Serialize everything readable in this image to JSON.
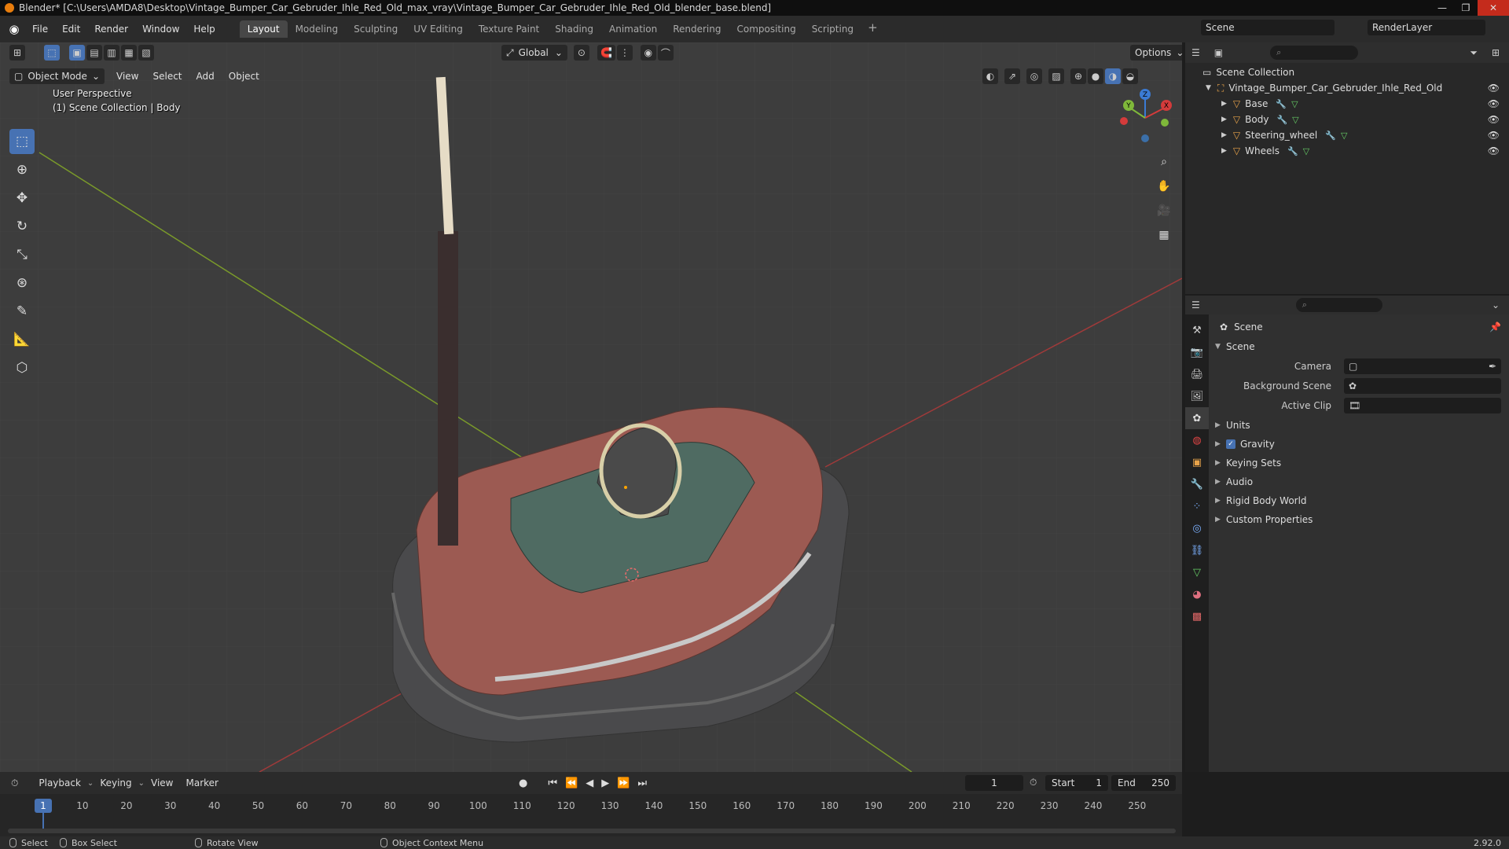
{
  "window": {
    "title": "Blender* [C:\\Users\\AMDA8\\Desktop\\Vintage_Bumper_Car_Gebruder_Ihle_Red_Old_max_vray\\Vintage_Bumper_Car_Gebruder_Ihle_Red_Old_blender_base.blend]"
  },
  "menu": {
    "file": "File",
    "edit": "Edit",
    "render": "Render",
    "window": "Window",
    "help": "Help"
  },
  "workspaces": [
    "Layout",
    "Modeling",
    "Sculpting",
    "UV Editing",
    "Texture Paint",
    "Shading",
    "Animation",
    "Rendering",
    "Compositing",
    "Scripting"
  ],
  "workspace_add": "+",
  "scene_selector": "Scene",
  "view_layer": "RenderLayer",
  "viewport": {
    "mode": "Object Mode",
    "menus": [
      "View",
      "Select",
      "Add",
      "Object"
    ],
    "orientation": "Global",
    "options": "Options",
    "perspective": "User Perspective",
    "collection_info": "(1) Scene Collection | Body",
    "gizmo": {
      "x": "X",
      "y": "Y",
      "z": "Z"
    }
  },
  "outliner": {
    "root": "Scene Collection",
    "collection": "Vintage_Bumper_Car_Gebruder_Ihle_Red_Old",
    "objects": [
      "Base",
      "Body",
      "Steering_wheel",
      "Wheels"
    ]
  },
  "properties": {
    "context": "Scene",
    "panel": "Scene",
    "camera_label": "Camera",
    "background_label": "Background Scene",
    "clip_label": "Active Clip",
    "subpanels": {
      "units": "Units",
      "gravity": "Gravity",
      "keying": "Keying Sets",
      "audio": "Audio",
      "rigid": "Rigid Body World",
      "custom": "Custom Properties"
    }
  },
  "timeline": {
    "playback": "Playback",
    "keying": "Keying",
    "view": "View",
    "marker": "Marker",
    "current_frame": "1",
    "start_label": "Start",
    "start": "1",
    "end_label": "End",
    "end": "250",
    "ticks": [
      "10",
      "20",
      "30",
      "40",
      "50",
      "60",
      "70",
      "80",
      "90",
      "100",
      "110",
      "120",
      "130",
      "140",
      "150",
      "160",
      "170",
      "180",
      "190",
      "200",
      "210",
      "220",
      "230",
      "240",
      "250"
    ],
    "cursor": "1"
  },
  "status": {
    "select": "Select",
    "box_select": "Box Select",
    "rotate": "Rotate View",
    "context_menu": "Object Context Menu",
    "version": "2.92.0"
  }
}
